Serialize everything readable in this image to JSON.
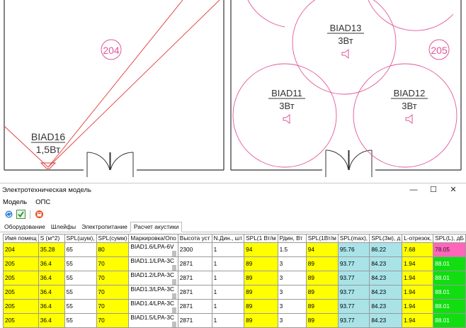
{
  "drawing": {
    "rooms": [
      {
        "label": "204"
      },
      {
        "label": "205"
      }
    ],
    "devices": [
      {
        "name": "BIAD16",
        "power": "1,5Вт"
      },
      {
        "name": "BIAD13",
        "power": "3Вт"
      },
      {
        "name": "BIAD11",
        "power": "3Вт"
      },
      {
        "name": "BIAD12",
        "power": "3Вт"
      }
    ],
    "colors": {
      "accent": "#e0569a",
      "wall": "#333333",
      "ray": "#e23a3a"
    }
  },
  "window": {
    "title": "Электротехническая модель",
    "minimize": "—",
    "maximize": "☐",
    "close": "✕"
  },
  "menu": {
    "items": [
      "Модель",
      "ОПС"
    ]
  },
  "toolbar": {
    "icons": [
      "refresh-icon",
      "check-icon",
      "calc-icon"
    ]
  },
  "tabs": [
    {
      "label": "Оборудование",
      "active": false
    },
    {
      "label": "Шлейфы",
      "active": false
    },
    {
      "label": "Электропитание",
      "active": false
    },
    {
      "label": "Расчет акустики",
      "active": true
    }
  ],
  "table": {
    "headers": [
      "Имя помещ",
      "S (м^2)",
      "SPL(шум),",
      "SPL(сумм)",
      "Маркировка/Опо",
      "Высота уст",
      "N.Дин., шт",
      "SPL(1 Вт/м",
      "Рдин, Вт",
      "SPL(1Вт/м",
      "SPL(max),",
      "SPL(3м), д",
      "L-отрезок,",
      "SPL(L), дБ"
    ],
    "rows": [
      [
        "204",
        "35.28",
        "65",
        "80",
        "BIAD1.6/LPA-6V",
        "2300",
        "1",
        "94",
        "1.5",
        "94",
        "95.76",
        "86.22",
        "7.68",
        "78.05"
      ],
      [
        "205",
        "36.4",
        "55",
        "70",
        "BIAD1.1/LPA-3C",
        "2871",
        "1",
        "89",
        "3",
        "89",
        "93.77",
        "84.23",
        "1.94",
        "88.01"
      ],
      [
        "205",
        "36.4",
        "55",
        "70",
        "BIAD1.2/LPA-3C",
        "2871",
        "1",
        "89",
        "3",
        "89",
        "93.77",
        "84.23",
        "1.94",
        "88.01"
      ],
      [
        "205",
        "36.4",
        "55",
        "70",
        "BIAD1.3/LPA-3C",
        "2871",
        "1",
        "89",
        "3",
        "89",
        "93.77",
        "84.23",
        "1.94",
        "88.01"
      ],
      [
        "205",
        "36.4",
        "55",
        "70",
        "BIAD1.4/LPA-3C",
        "2871",
        "1",
        "89",
        "3",
        "89",
        "93.77",
        "84.23",
        "1.94",
        "88.01"
      ],
      [
        "205",
        "36.4",
        "55",
        "70",
        "BIAD1.5/LPA-3C",
        "2871",
        "1",
        "89",
        "3",
        "89",
        "93.77",
        "84.23",
        "1.94",
        "88.01"
      ]
    ],
    "cell_colors": [
      "#ffff00",
      "#a9e3e8",
      "#11dd11",
      "#ff66bb"
    ]
  }
}
